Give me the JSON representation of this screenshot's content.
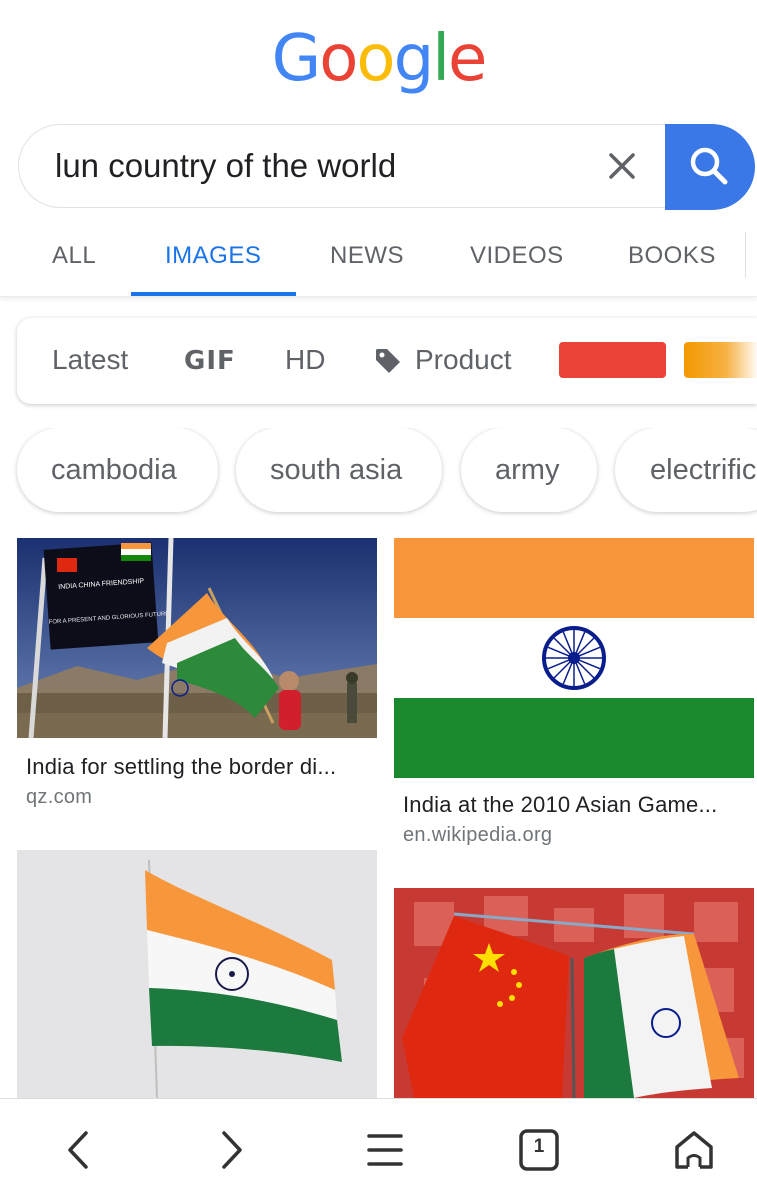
{
  "logo": {
    "letters": [
      {
        "char": "G",
        "color": "#4285F4"
      },
      {
        "char": "o",
        "color": "#EA4335"
      },
      {
        "char": "o",
        "color": "#FBBC05"
      },
      {
        "char": "g",
        "color": "#4285F4"
      },
      {
        "char": "l",
        "color": "#34A853"
      },
      {
        "char": "e",
        "color": "#EA4335"
      }
    ]
  },
  "search": {
    "query": "lun country of the world"
  },
  "tabs": [
    {
      "label": "ALL",
      "active": false
    },
    {
      "label": "IMAGES",
      "active": true
    },
    {
      "label": "NEWS",
      "active": false
    },
    {
      "label": "VIDEOS",
      "active": false
    },
    {
      "label": "BOOKS",
      "active": false
    }
  ],
  "filters": {
    "latest": "Latest",
    "gif": "GIF",
    "hd": "HD",
    "product": "Product",
    "color_swatches": [
      "#ea4335",
      "#f29900"
    ]
  },
  "chips": [
    "cambodia",
    "south asia",
    "army",
    "electrific"
  ],
  "results": [
    {
      "caption": "India for settling the border di...",
      "source": "qz.com"
    },
    {
      "caption": "India at the 2010 Asian Game...",
      "source": "en.wikipedia.org"
    },
    {
      "caption": "",
      "source": ""
    },
    {
      "caption": "",
      "source": ""
    }
  ],
  "image_text": {
    "sign": [
      "INDIA CHINA FRIENDSHIP",
      "FOR A PRESENT AND GLORIOUS FUTURE"
    ]
  },
  "bottom_nav": {
    "tab_count": "1",
    "icons": [
      "back-icon",
      "forward-icon",
      "menu-icon",
      "tabs-icon",
      "home-icon"
    ]
  },
  "colors": {
    "accent": "#1a73e8",
    "search_button": "#3b78e7",
    "saffron": "#F7963A",
    "india_green": "#138808",
    "chakra": "#0a1d8c",
    "china_red": "#de2910"
  }
}
